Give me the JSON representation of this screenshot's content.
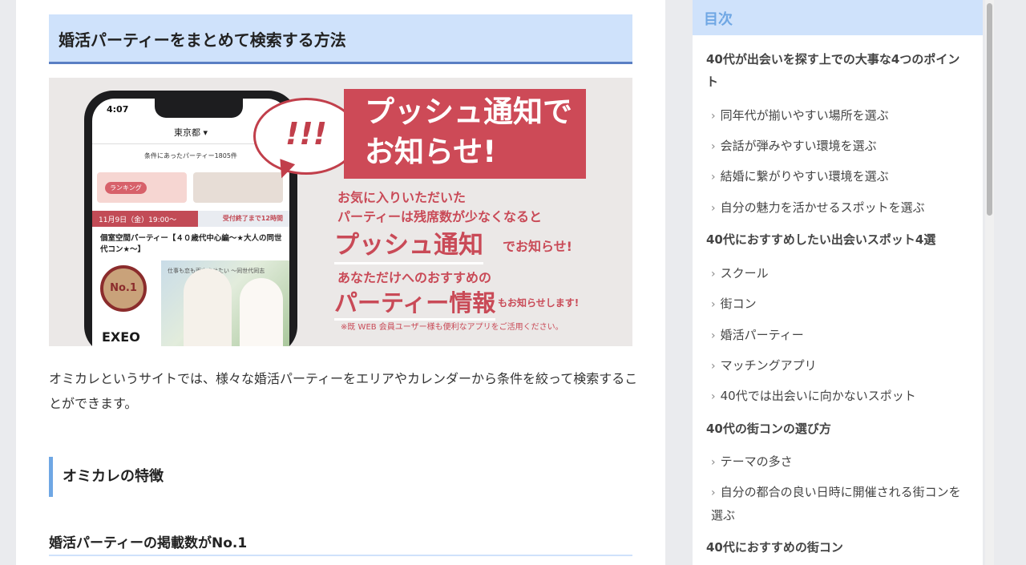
{
  "article": {
    "heading": "婚活パーティーをまとめて検索する方法",
    "paragraph": "オミカレというサイトでは、様々な婚活パーティーをエリアやカレンダーから条件を絞って検索することができます。",
    "h3": "オミカレの特徴",
    "h4": "婚活パーティーの掲載数がNo.1"
  },
  "banner": {
    "phone_time": "4:07",
    "phone_location": "東京都 ▾",
    "phone_filter": "条件にあったパーティー1805件",
    "phone_chip": "ランキング",
    "phone_date": "11月9日（金）19:00〜",
    "phone_deadline": "受付終了まで12時間",
    "phone_party": "個室空間パーティー【４０歳代中心編〜★大人の同世代コン★〜】",
    "phone_photo_caption": "仕事も恋も両立させたい 〜同世代同志",
    "phone_badge": "No.1",
    "phone_logo": "EXEO",
    "bubble": "!!!",
    "headline_1": "プッシュ通知で",
    "headline_2": "お知らせ!",
    "line_1": "お気に入りいただいた",
    "line_2": "パーティーは残席数が少なくなると",
    "push": "プッシュ通知",
    "push_sub": "でお知らせ!",
    "line_3": "あなただけへのおすすめの",
    "info": "パーティー情報",
    "info_sub": "もお知らせします!",
    "note": "※既 WEB 会員ユーザー様も便利なアプリをご活用ください。"
  },
  "toc": {
    "title": "目次",
    "items": [
      {
        "type": "h",
        "label": "40代が出会いを探す上での大事な4つのポイント"
      },
      {
        "type": "s",
        "label": "同年代が揃いやすい場所を選ぶ"
      },
      {
        "type": "s",
        "label": "会話が弾みやすい環境を選ぶ"
      },
      {
        "type": "s",
        "label": "結婚に繋がりやすい環境を選ぶ"
      },
      {
        "type": "s",
        "label": "自分の魅力を活かせるスポットを選ぶ"
      },
      {
        "type": "h",
        "label": "40代におすすめしたい出会いスポット4選"
      },
      {
        "type": "s",
        "label": "スクール"
      },
      {
        "type": "s",
        "label": "街コン"
      },
      {
        "type": "s",
        "label": "婚活パーティー"
      },
      {
        "type": "s",
        "label": "マッチングアプリ"
      },
      {
        "type": "s",
        "label": "40代では出会いに向かないスポット"
      },
      {
        "type": "h",
        "label": "40代の街コンの選び方"
      },
      {
        "type": "s",
        "label": "テーマの多さ"
      },
      {
        "type": "s",
        "label": "自分の都合の良い日時に開催される街コンを選ぶ"
      },
      {
        "type": "h",
        "label": "40代におすすめの街コン"
      }
    ]
  },
  "colors": {
    "accent_light": "#cfe2fb",
    "accent": "#6fa7e4",
    "banner_red": "#cd4a57"
  }
}
